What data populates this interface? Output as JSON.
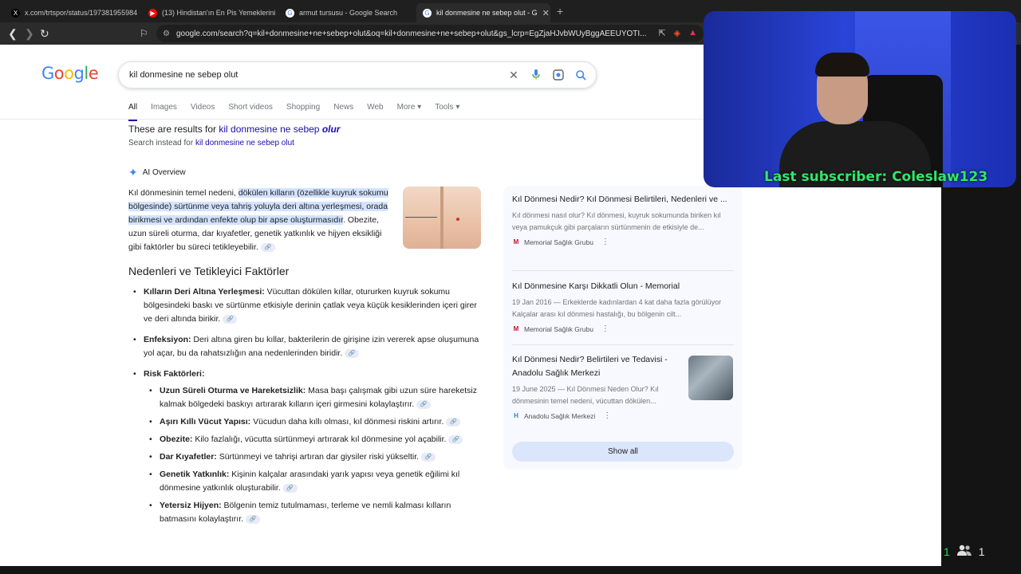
{
  "browser": {
    "tabs": [
      {
        "label": "x.com/trtspor/status/197381955984",
        "favicon": "X",
        "favcolor": "#000000"
      },
      {
        "label": "(13) Hindistan'ın En Pis Yemeklerini Y",
        "favicon": "▶",
        "favcolor": "#ff0000"
      },
      {
        "label": "armut tursusu - Google Search",
        "favicon": "G",
        "favcolor": "#4285f4"
      },
      {
        "label": "kil donmesine ne sebep olut - G",
        "favicon": "G",
        "favcolor": "#4285f4"
      }
    ],
    "url": "google.com/search?q=kil+donmesine+ne+sebep+olut&oq=kil+donmesine+ne+sebep+olut&gs_lcrp=EgZjaHJvbWUyBggAEEUYOTI..."
  },
  "search": {
    "query": "kil donmesine ne sebep olut",
    "logo": "Google",
    "tabs": [
      "All",
      "Images",
      "Videos",
      "Short videos",
      "Shopping",
      "News",
      "Web",
      "More",
      "Tools"
    ]
  },
  "correction": {
    "prefix": "These are results for ",
    "corrected_plain": "kil donmesine ne sebep ",
    "corrected_bold": "olur",
    "instead_prefix": "Search instead for ",
    "instead_query": "kil donmesine ne sebep olut"
  },
  "ai_overview": {
    "label": "AI Overview",
    "intro_start": "Kıl dönmesinin temel nedeni, ",
    "intro_highlight": "dökülen kılların (özellikle kuyruk sokumu bölgesinde) sürtünme veya tahriş yoluyla deri altına yerleşmesi, orada birikmesi ve ardından enfekte olup bir apse oluşturmasıdır",
    "intro_end": ". Obezite, uzun süreli oturma, dar kıyafetler, genetik yatkınlık ve hijyen eksikliği gibi faktörler bu süreci tetikleyebilir.",
    "heading": "Nedenleri ve Tetikleyici Faktörler",
    "items": [
      {
        "title": "Kılların Deri Altına Yerleşmesi:",
        "text": " Vücuttan dökülen kıllar, otururken kuyruk sokumu bölgesindeki baskı ve sürtünme etkisiyle derinin çatlak veya küçük kesiklerinden içeri girer ve deri altında birikir."
      },
      {
        "title": "Enfeksiyon:",
        "text": " Deri altına giren bu kıllar, bakterilerin de girişine izin vererek apse oluşumuna yol açar, bu da rahatsızlığın ana nedenlerinden biridir."
      },
      {
        "title": "Risk Faktörleri:",
        "text": ""
      }
    ],
    "subitems": [
      {
        "title": "Uzun Süreli Oturma ve Hareketsizlik:",
        "text": " Masa başı çalışmak gibi uzun süre hareketsiz kalmak bölgedeki baskıyı artırarak kılların içeri girmesini kolaylaştırır."
      },
      {
        "title": "Aşırı Kıllı Vücut Yapısı:",
        "text": " Vücudun daha kıllı olması, kıl dönmesi riskini artırır."
      },
      {
        "title": "Obezite:",
        "text": " Kilo fazlalığı, vücutta sürtünmeyi artırarak kıl dönmesine yol açabilir."
      },
      {
        "title": "Dar Kıyafetler:",
        "text": " Sürtünmeyi ve tahrişi artıran dar giysiler riski yükseltir."
      },
      {
        "title": "Genetik Yatkınlık:",
        "text": " Kişinin kalçalar arasındaki yarık yapısı veya genetik eğilimi kıl dönmesine yatkınlık oluşturabilir."
      },
      {
        "title": "Yetersiz Hijyen:",
        "text": " Bölgenin temiz tutulmaması, terleme ve nemli kalması kılların batmasını kolaylaştırır."
      }
    ]
  },
  "sources": [
    {
      "title": "Kıl Dönmesi Nedir? Kıl Dönmesi Belirtileri, Nedenleri ve ...",
      "desc": "Kıl dönmesi nasıl olur? Kıl dönmesi, kuyruk sokumunda biriken kıl veya pamukçuk gibi parçaların sürtünmenin de etkisiyle de...",
      "site": "Memorial Sağlık Grubu",
      "icon": "M",
      "iconcolor": "#c8102e"
    },
    {
      "title": "Kıl Dönmesine Karşı Dikkatli Olun - Memorial",
      "desc": "19 Jan 2016 — Erkeklerde kadınlardan 4 kat daha fazla görülüyor Kalçalar arası kıl dönmesi hastalığı, bu bölgenin cilt...",
      "site": "Memorial Sağlık Grubu",
      "icon": "M",
      "iconcolor": "#c8102e"
    },
    {
      "title": "Kıl Dönmesi Nedir? Belirtileri ve Tedavisi - Anadolu Sağlık Merkezi",
      "desc": "19 June 2025 — Kıl Dönmesi Neden Olur? Kıl dönmesinin temel nedeni, vücuttan dökülen...",
      "site": "Anadolu Sağlık Merkezi",
      "icon": "H",
      "iconcolor": "#1e88c8"
    }
  ],
  "show_all": "Show all",
  "stream": {
    "overlay": "Last subscriber: Coleslaw123",
    "viewers_a": "1",
    "viewers_b": "1"
  }
}
